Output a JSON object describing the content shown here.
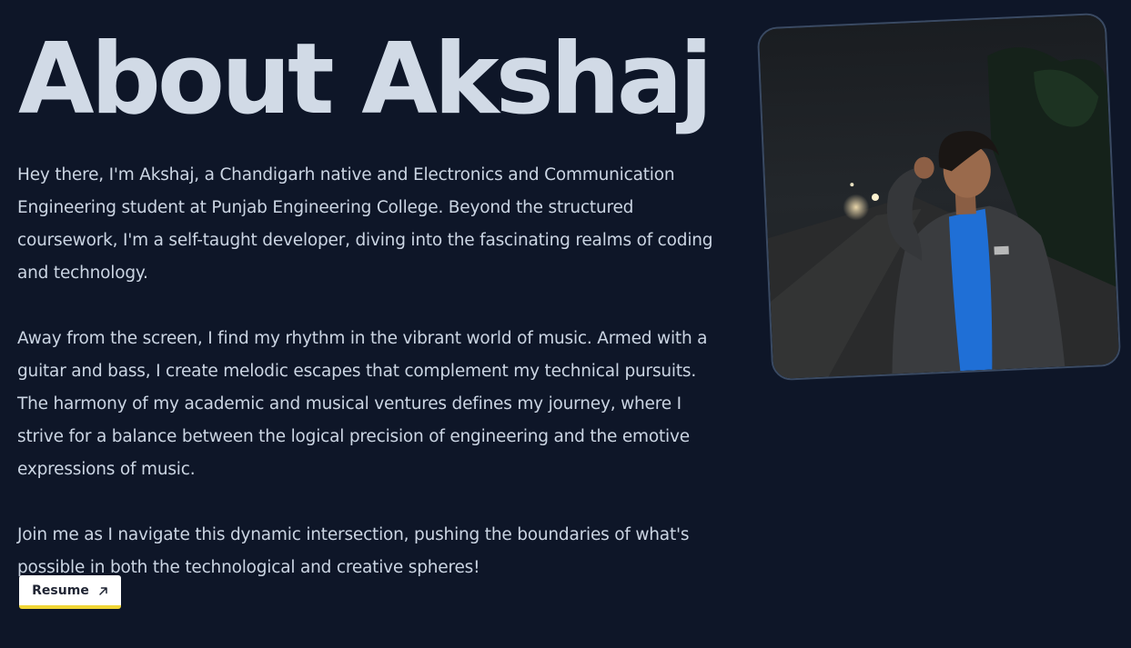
{
  "heading": "About Akshaj",
  "paragraphs": [
    "Hey there, I'm Akshaj, a Chandigarh native and Electronics and Communication Engineering student at Punjab Engineering College. Beyond the structured coursework, I'm a self-taught developer, diving into the fascinating realms of coding and technology.",
    "Away from the screen, I find my rhythm in the vibrant world of music. Armed with a guitar and bass, I create melodic escapes that complement my technical pursuits. The harmony of my academic and musical ventures defines my journey, where I strive for a balance between the logical precision of engineering and the emotive expressions of music.",
    "Join me as I navigate this dynamic intersection, pushing the boundaries of what's possible in both the technological and creative spheres!"
  ],
  "resume_button": {
    "label": "Resume",
    "icon": "arrow-up-right-icon"
  },
  "photo": {
    "icon": "profile-photo"
  },
  "colors": {
    "background": "#0e1628",
    "heading": "#d1dae6",
    "text": "#cbd5e3",
    "button_bg": "#ffffff",
    "button_accent": "#f0d535",
    "jacket_shirt": "#1f6fd6"
  }
}
